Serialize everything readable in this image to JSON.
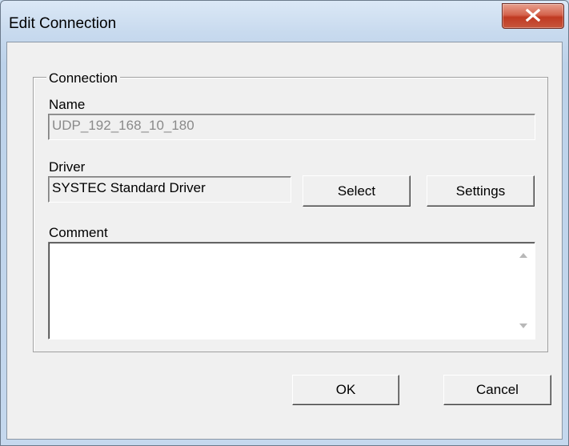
{
  "window": {
    "title": "Edit Connection",
    "close_glyph": "X"
  },
  "group": {
    "legend": "Connection"
  },
  "name": {
    "label": "Name",
    "value": "UDP_192_168_10_180"
  },
  "driver": {
    "label": "Driver",
    "value": "SYSTEC Standard Driver",
    "select_label": "Select",
    "settings_label": "Settings"
  },
  "comment": {
    "label": "Comment",
    "value": ""
  },
  "footer": {
    "ok_label": "OK",
    "cancel_label": "Cancel"
  },
  "colors": {
    "close_button": "#c7563c",
    "client_bg": "#f0f0f0",
    "frame": "#c8daee"
  },
  "icons": [
    "close-icon",
    "scroll-up-icon",
    "scroll-down-icon"
  ]
}
